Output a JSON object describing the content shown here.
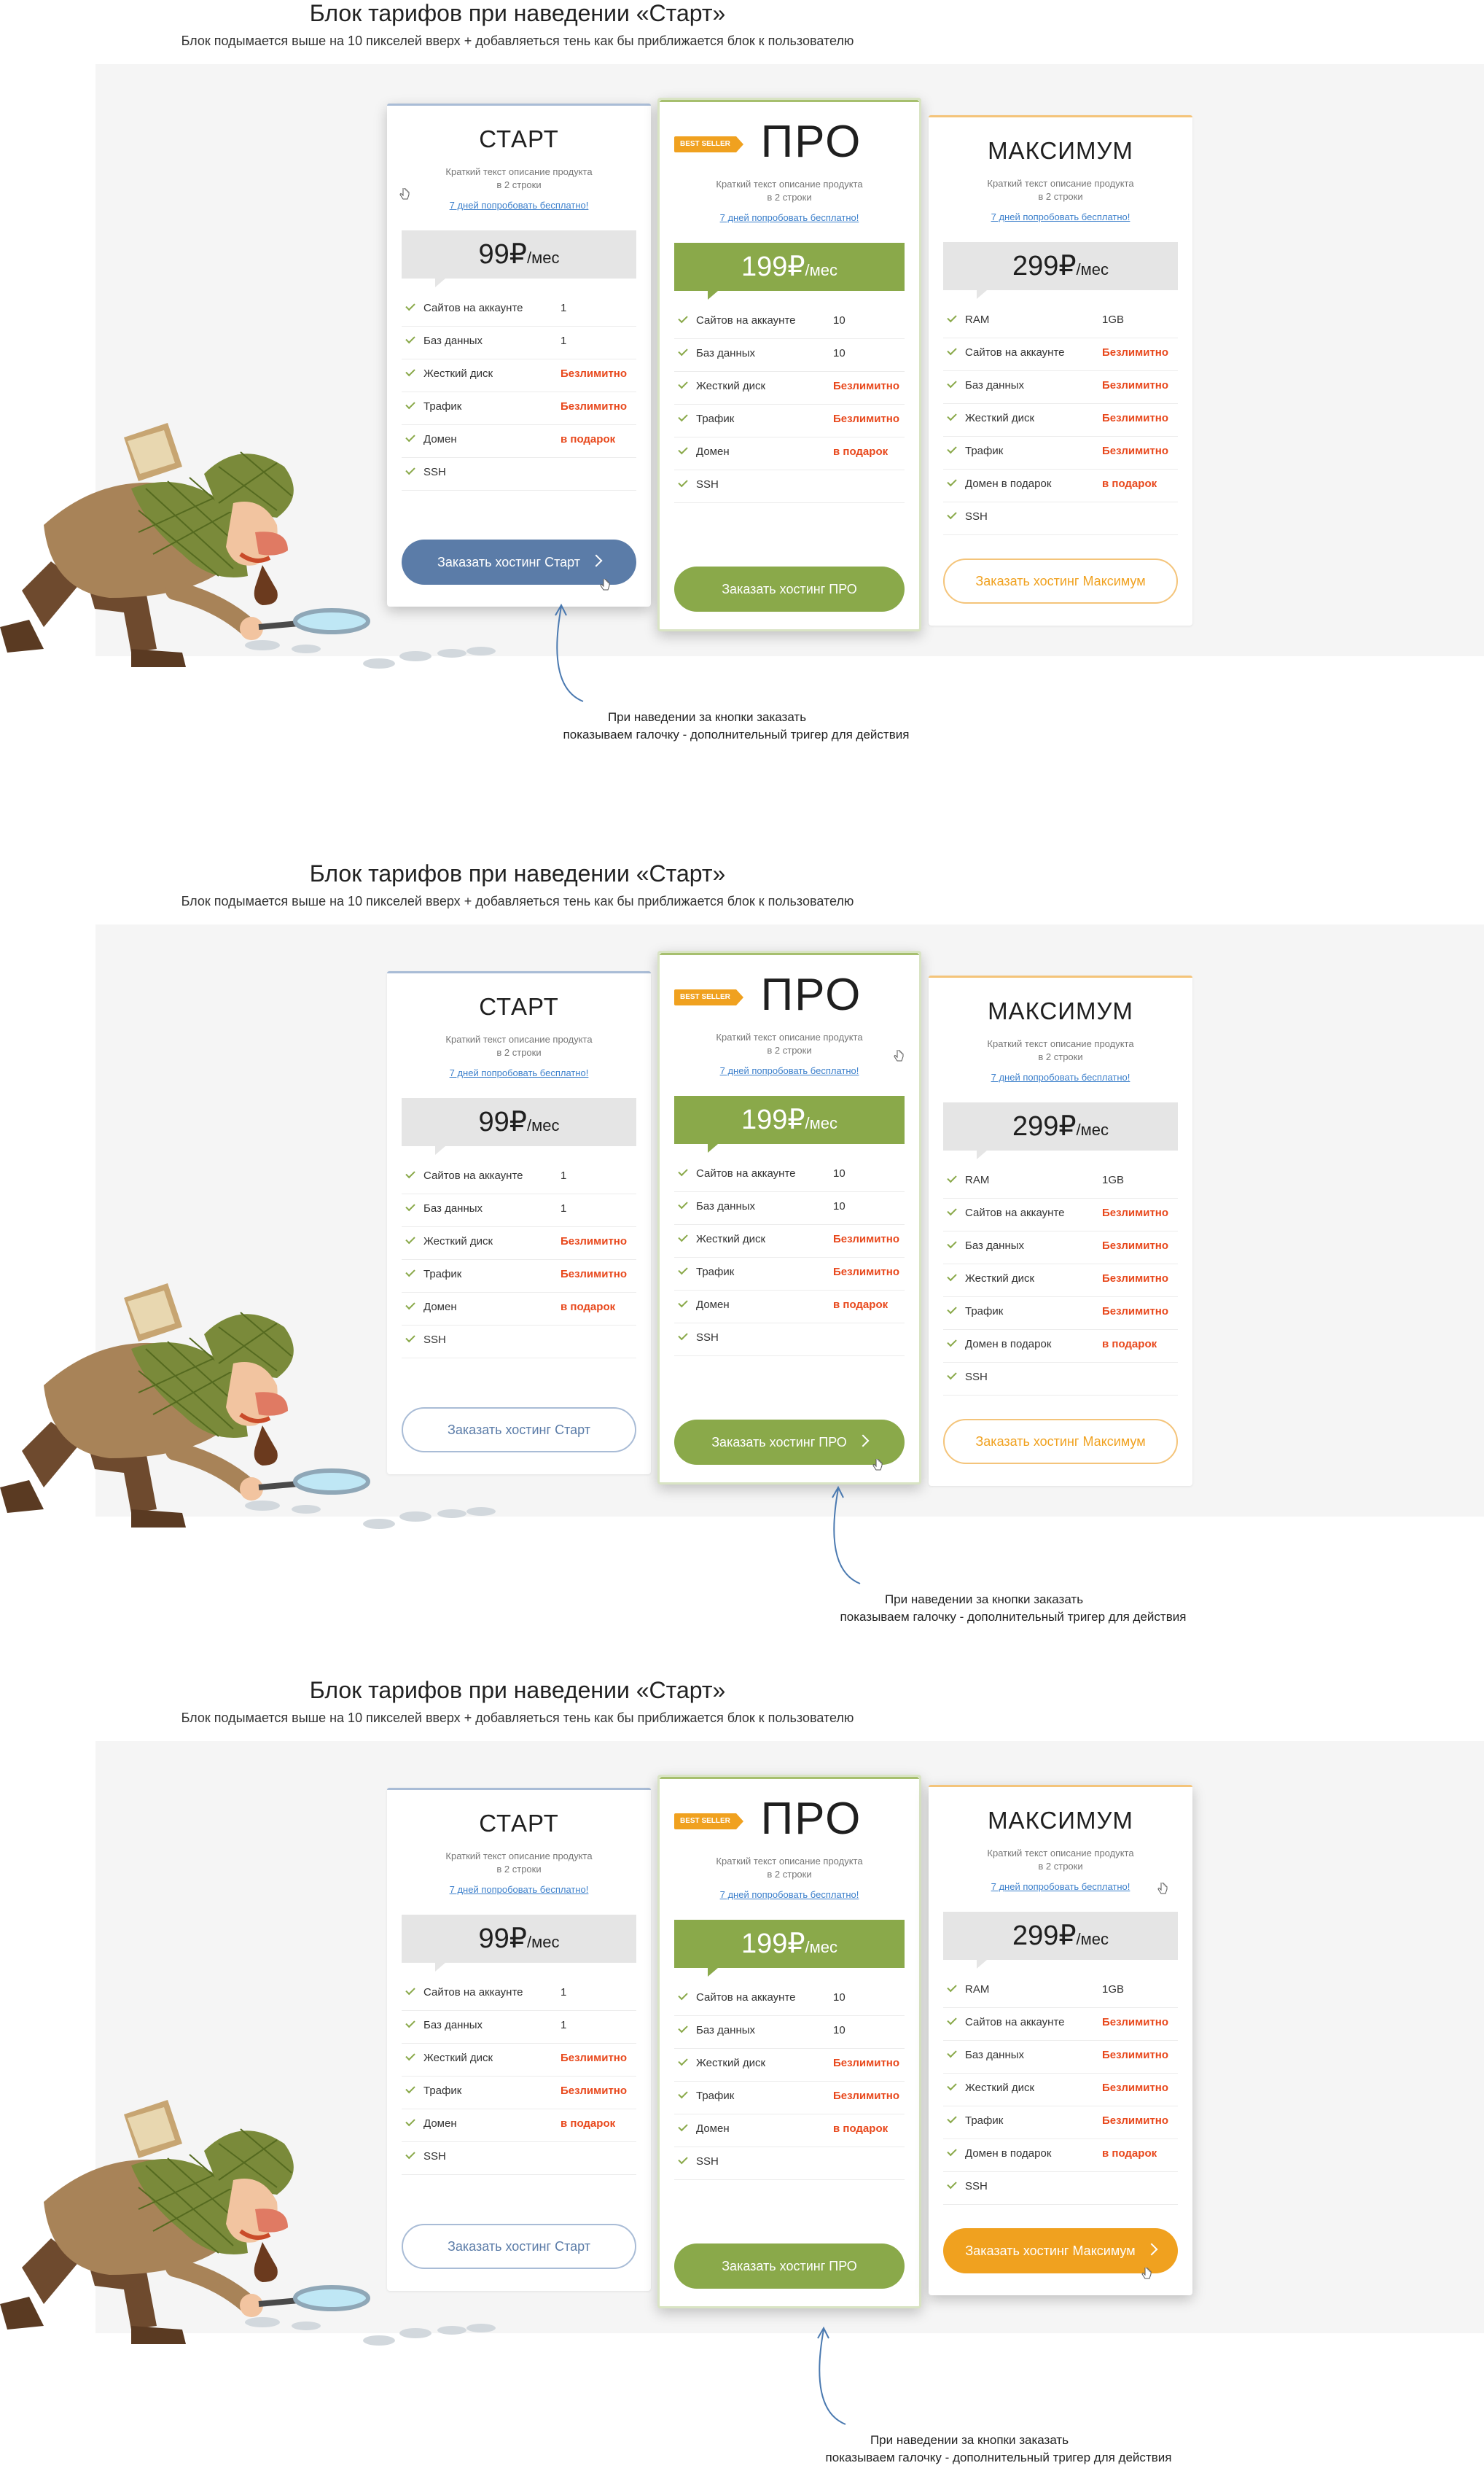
{
  "sections": [
    {
      "title": "Блок тарифов при наведении «Старт»",
      "subtitle": "Блок подымается выше на 10 пикселей вверх + добавляеться тень как бы приближается блок к пользователю",
      "note_line1": "При наведении за кнопки заказать",
      "note_line2": "показываем галочку - дополнительный тригер для действия"
    },
    {
      "title": "Блок тарифов при наведении «Старт»",
      "subtitle": "Блок подымается выше на 10 пикселей вверх + добавляеться тень как бы приближается блок к пользователю",
      "note_line1": "При наведении за кнопки заказать",
      "note_line2": "показываем галочку - дополнительный тригер для действия"
    },
    {
      "title": "Блок тарифов при наведении «Старт»",
      "subtitle": "Блок подымается выше на 10 пикселей вверх + добавляеться тень как бы приближается блок к пользователю",
      "note_line1": "При наведении за кнопки заказать",
      "note_line2": "показываем галочку - дополнительный тригер для действия"
    }
  ],
  "plans": {
    "start": {
      "name": "СТАРТ",
      "desc_line1": "Краткий текст описание продукта",
      "desc_line2": "в 2 строки",
      "trial": "7 дней попробовать бесплатно!",
      "price": "99₽",
      "unit": "/мес",
      "button": "Заказать хостинг Старт",
      "features": [
        {
          "label": "Сайтов на аккаунте",
          "value": "1"
        },
        {
          "label": "Баз данных",
          "value": "1"
        },
        {
          "label": "Жесткий диск",
          "value": "Безлимитно"
        },
        {
          "label": "Трафик",
          "value": "Безлимитно"
        },
        {
          "label": "Домен",
          "value": "в подарок"
        },
        {
          "label": "SSH",
          "value": ""
        }
      ]
    },
    "pro": {
      "badge": "BEST SELLER",
      "name": "ПРО",
      "desc_line1": "Краткий текст описание продукта",
      "desc_line2": "в 2 строки",
      "trial": "7 дней попробовать бесплатно!",
      "price": "199₽",
      "unit": "/мес",
      "button": "Заказать хостинг ПРО",
      "features": [
        {
          "label": "Сайтов на аккаунте",
          "value": "10"
        },
        {
          "label": "Баз данных",
          "value": "10"
        },
        {
          "label": "Жесткий диск",
          "value": "Безлимитно"
        },
        {
          "label": "Трафик",
          "value": "Безлимитно"
        },
        {
          "label": "Домен",
          "value": "в подарок"
        },
        {
          "label": "SSH",
          "value": ""
        }
      ]
    },
    "max": {
      "name": "МАКСИМУМ",
      "desc_line1": "Краткий текст описание продукта",
      "desc_line2": "в 2 строки",
      "trial": "7 дней попробовать бесплатно!",
      "price": "299₽",
      "unit": "/мес",
      "button": "Заказать хостинг Максимум",
      "features": [
        {
          "label": "RAM",
          "value": "1GB"
        },
        {
          "label": "Сайтов на аккаунте",
          "value": "Безлимитно"
        },
        {
          "label": "Баз данных",
          "value": "Безлимитно"
        },
        {
          "label": "Жесткий диск",
          "value": "Безлимитно"
        },
        {
          "label": "Трафик",
          "value": "Безлимитно"
        },
        {
          "label": "Домен в подарок",
          "value": "в подарок"
        },
        {
          "label": "SSH",
          "value": ""
        }
      ]
    }
  },
  "colors": {
    "start_accent": "#5b7ca8",
    "pro_accent": "#8aa94a",
    "max_accent": "#f0a11f",
    "highlight_value": "#e8481c"
  }
}
